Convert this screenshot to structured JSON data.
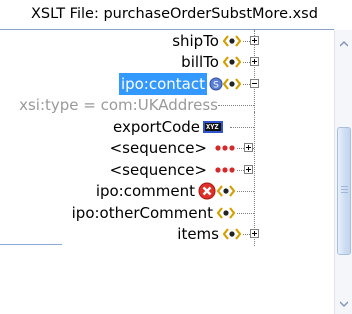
{
  "title": "XSLT File: purchaseOrderSubstMore.xsd",
  "nodes": [
    {
      "label": "shipTo",
      "icon": "element-icon",
      "toggle": "expand"
    },
    {
      "label": "billTo",
      "icon": "element-icon",
      "toggle": "expand"
    },
    {
      "label": "ipo:contact",
      "icon": "substitution-element-icon",
      "toggle": "collapse",
      "selected": true
    },
    {
      "label": "xsi:type = com:UKAddress",
      "icon": "",
      "toggle": ""
    },
    {
      "label": "exportCode",
      "icon": "simple-type-icon",
      "toggle": ""
    },
    {
      "label": "<sequence>",
      "icon": "sequence-icon",
      "toggle": "expand"
    },
    {
      "label": "<sequence>",
      "icon": "sequence-icon",
      "toggle": "expand"
    },
    {
      "label": "ipo:comment",
      "icon": "error-element-icon",
      "toggle": ""
    },
    {
      "label": "ipo:otherComment",
      "icon": "element-icon",
      "toggle": ""
    },
    {
      "label": "items",
      "icon": "element-icon",
      "toggle": "expand"
    }
  ],
  "icon_text": {
    "simple_type": "XYZ"
  },
  "colors": {
    "selection": "#3399ff",
    "element_icon": "#e8b400",
    "error": "#e0302a",
    "mapping_line": "#8fa6d8"
  }
}
